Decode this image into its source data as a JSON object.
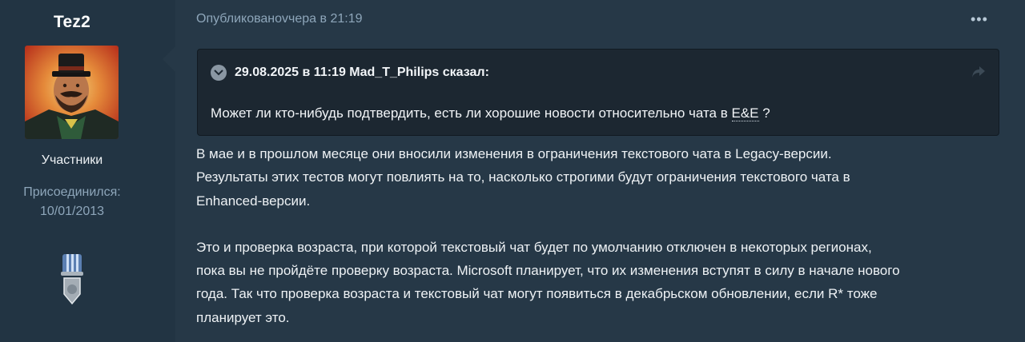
{
  "user": {
    "name": "Tez2",
    "role": "Участники",
    "joined_label": "Присоединился:",
    "joined_date": "10/01/2013"
  },
  "post": {
    "date": "Опубликованovчера в 21:19",
    "menu_label": "•••"
  },
  "quote": {
    "author_line": "29.08.2025 в 11:19 Mad_T_Philips сказал:",
    "text_prefix": "Может ли кто-нибудь подтвердить, есть ли хорошие новости относительно чата в ",
    "abbr": "E&E",
    "text_suffix": " ?"
  },
  "message": {
    "paragraph1_lines": [
      "В мае и в прошлом месяце они вносили изменения в ограничения текстового чата в Legacy-версии.",
      "Результаты этих тестов могут повлиять на то, насколько строгими будут ограничения текстового чата в",
      "Enhanced-версии."
    ],
    "paragraph2_lines": [
      "Это и проверка возраста, при которой текстовый чат будет по умолчанию отключен в некоторых регионах,",
      "пока вы не пройдёте проверку возраста. Microsoft планирует, что их изменения вступят в силу в начале нового",
      "года. Так что проверка возраста и текстовый чат могут появиться в декабрьском обновлении, если R* тоже",
      "планирует это."
    ]
  },
  "icons": {
    "quote_toggle": "chevron-down-icon",
    "quote_jump": "share-arrow-icon",
    "medal": "medal-icon"
  },
  "colors": {
    "background": "#263847",
    "sidebar": "#223443",
    "quote_bg": "#1c2731",
    "muted_text": "#8ea6ba"
  }
}
